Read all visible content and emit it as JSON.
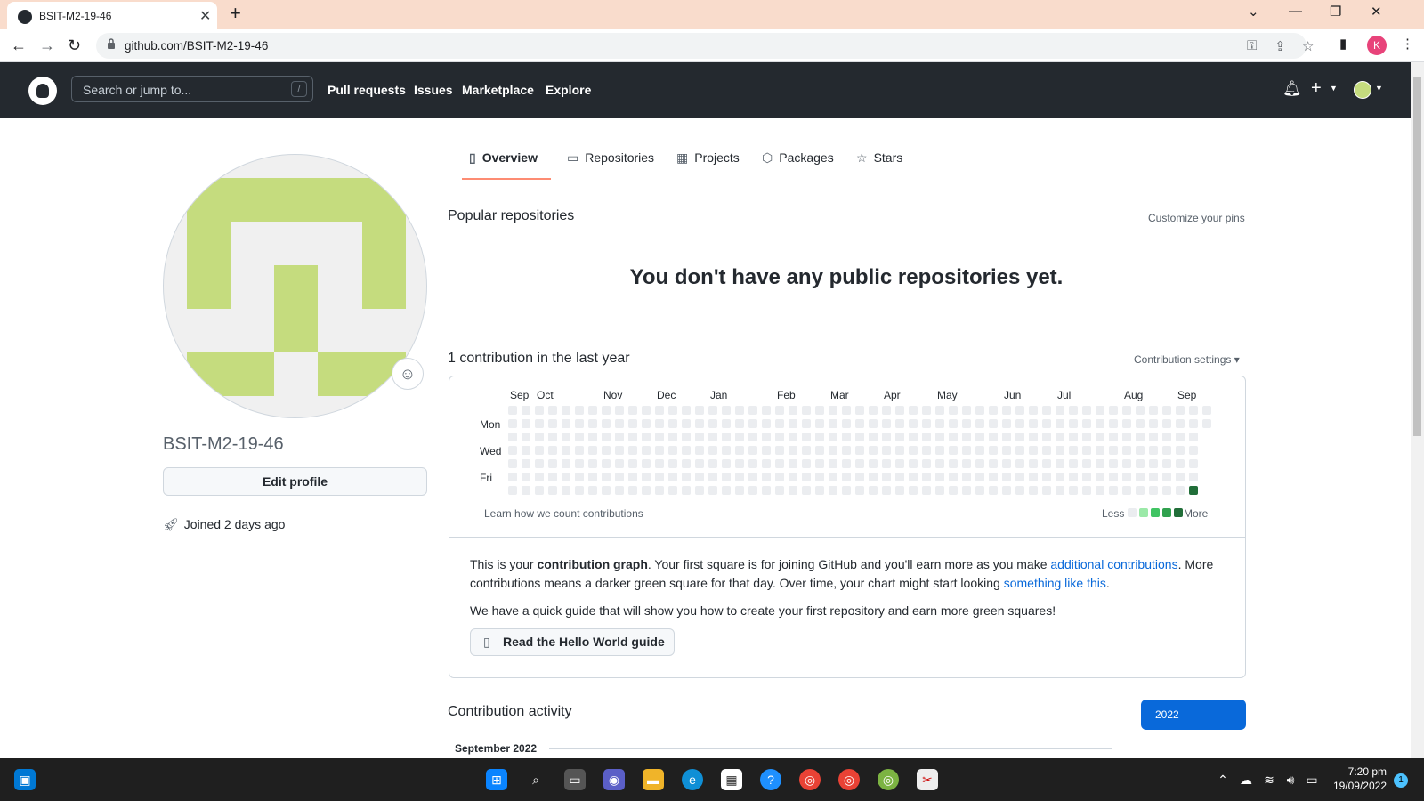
{
  "browser": {
    "tab_title": "BSIT-M2-19-46",
    "url": "github.com/BSIT-M2-19-46",
    "profile_initial": "K"
  },
  "header": {
    "search_placeholder": "Search or jump to...",
    "search_shortcut": "/",
    "nav": [
      "Pull requests",
      "Issues",
      "Marketplace",
      "Explore"
    ]
  },
  "profile_tabs": [
    "Overview",
    "Repositories",
    "Projects",
    "Packages",
    "Stars"
  ],
  "profile": {
    "username": "BSIT-M2-19-46",
    "edit_label": "Edit profile",
    "joined": "Joined 2 days ago"
  },
  "popular": {
    "title": "Popular repositories",
    "customize": "Customize your pins",
    "empty": "You don't have any public repositories yet."
  },
  "contributions": {
    "title": "1 contribution in the last year",
    "settings": "Contribution settings ▾",
    "months": [
      "Sep",
      "Oct",
      "Nov",
      "Dec",
      "Jan",
      "Feb",
      "Mar",
      "Apr",
      "May",
      "Jun",
      "Jul",
      "Aug",
      "Sep"
    ],
    "days": [
      "Mon",
      "Wed",
      "Fri"
    ],
    "learn": "Learn how we count contributions",
    "less": "Less",
    "more": "More",
    "colors": {
      "empty": "#ebedf0",
      "l1": "#9be9a8",
      "l2": "#40c463",
      "l3": "#30a14e",
      "l4": "#216e39"
    }
  },
  "info": {
    "p1_a": "This is your ",
    "p1_b": "contribution graph",
    "p1_c": ". Your first square is for joining GitHub and you'll earn more as you make ",
    "p1_link1": "additional contributions",
    "p1_d": ". More contributions means a darker green square for that day. Over time, your chart might start looking ",
    "p1_link2": "something like this",
    "p1_e": ".",
    "p2": "We have a quick guide that will show you how to create your first repository and earn more green squares!",
    "guide_button": "Read the Hello World guide"
  },
  "activity": {
    "title": "Contribution activity",
    "year": "2022",
    "month": "September 2022"
  },
  "taskbar": {
    "time": "7:20 pm",
    "date": "19/09/2022",
    "notifications": "1"
  },
  "icons": [
    "github-logo-icon",
    "bell-icon",
    "plus-icon",
    "book-icon",
    "repo-icon",
    "project-icon",
    "package-icon",
    "star-icon",
    "smiley-icon",
    "rocket-icon"
  ]
}
